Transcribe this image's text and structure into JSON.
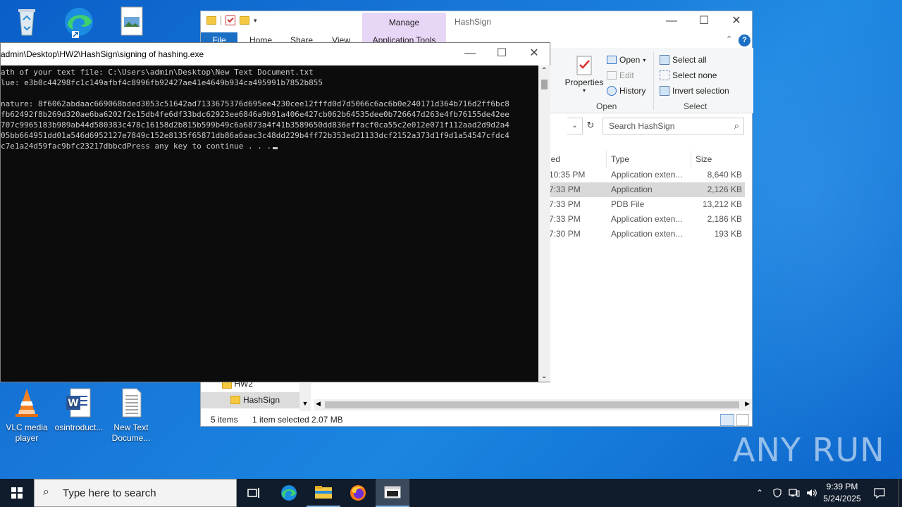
{
  "desktop": {
    "icons_top": [
      {
        "name": "recycle-bin",
        "label": ""
      },
      {
        "name": "edge",
        "label": ""
      },
      {
        "name": "picture-file",
        "label": ""
      }
    ],
    "icons_bottom": [
      {
        "name": "vlc",
        "label": "VLC media player"
      },
      {
        "name": "word-doc",
        "label": "osintroduct..."
      },
      {
        "name": "text-doc",
        "label": "New Text Docume..."
      }
    ]
  },
  "explorer": {
    "title": "HashSign",
    "manage_tab": "Manage",
    "tabs": {
      "file": "File",
      "home": "Home",
      "share": "Share",
      "view": "View",
      "app_tools": "Application Tools"
    },
    "ribbon": {
      "properties": "Properties",
      "open": "Open",
      "edit": "Edit",
      "history": "History",
      "open_group": "Open",
      "select_all": "Select all",
      "select_none": "Select none",
      "invert_selection": "Invert selection",
      "select_group": "Select"
    },
    "search_placeholder": "Search HashSign",
    "columns": {
      "modified": "ied",
      "type": "Type",
      "size": "Size"
    },
    "rows": [
      {
        "time": "10:35 PM",
        "type": "Application exten...",
        "size": "8,640 KB",
        "selected": false
      },
      {
        "time": "7:33 PM",
        "type": "Application",
        "size": "2,126 KB",
        "selected": true
      },
      {
        "time": "7:33 PM",
        "type": "PDB File",
        "size": "13,212 KB",
        "selected": false
      },
      {
        "time": "7:33 PM",
        "type": "Application exten...",
        "size": "2,186 KB",
        "selected": false
      },
      {
        "time": "7:30 PM",
        "type": "Application exten...",
        "size": "193 KB",
        "selected": false
      }
    ],
    "nav": {
      "hw2": "HW2",
      "hashsign": "HashSign"
    },
    "status": {
      "items": "5 items",
      "selected": "1 item selected",
      "size": "2.07 MB"
    }
  },
  "console": {
    "title": "admin\\Desktop\\HW2\\HashSign\\signing of hashing.exe",
    "lines": [
      "ath of your text file: C:\\Users\\admin\\Desktop\\New Text Document.txt",
      "lue: e3b0c44298fc1c149afbf4c8996fb92427ae41e4649b934ca495991b7852b855",
      "",
      "nature: 8f6062abdaac669068bded3053c51642ad7133675376d695ee4230cee12fffd0d7d5066c6ac6b0e240171d364b716d2ff6bc8",
      "fb62492f8b269d320ae6ba6202f2e15db4fe6df33bdc62923ee6846a9b91a406e427cb062b64535dee0b726647d263e4fb76155de42ee",
      "707c9965183b989ab44d580383c478c16158d2b815b599b49c6a6873a4f41b3589650dd836effacf0ca55c2e012e071f112aad2d9d2a4",
      "05bb664951dd01a546d6952127e7849c152e8135f65871db86a6aac3c48dd229b4ff72b353ed21133dcf2152a373d1f9d1a54547cfdc4",
      "c7e1a24d59fac9bfc23217dbbcdPress any key to continue . . ."
    ]
  },
  "taskbar": {
    "search_placeholder": "Type here to search",
    "time": "9:39 PM",
    "date": "5/24/2025"
  },
  "watermark": "ANY RUN"
}
